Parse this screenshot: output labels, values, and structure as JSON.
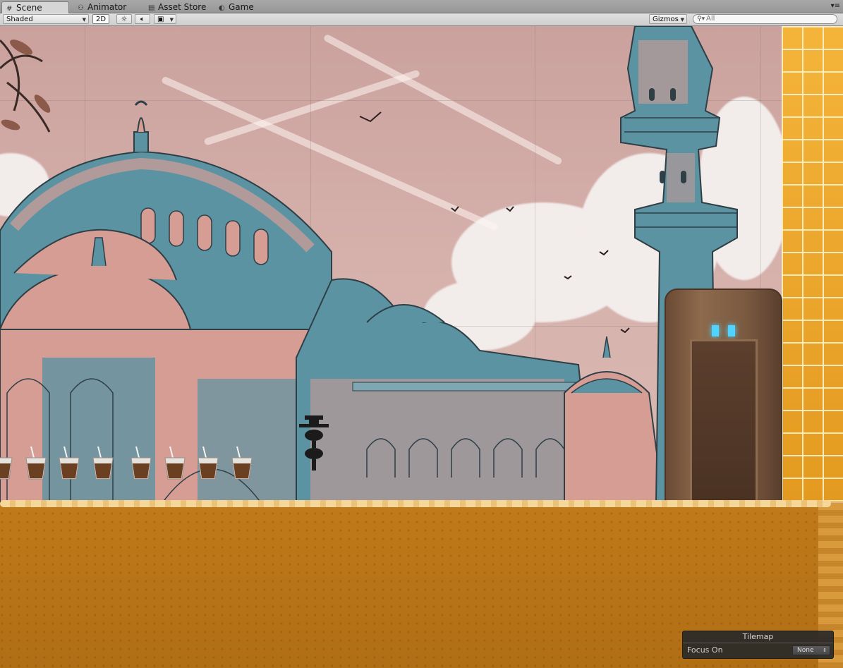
{
  "tabs": [
    {
      "label": "Scene",
      "icon": "grid-icon",
      "active": true
    },
    {
      "label": "Animator",
      "icon": "animator-icon",
      "active": false
    },
    {
      "label": "Asset Store",
      "icon": "store-icon",
      "active": false
    },
    {
      "label": "Game",
      "icon": "game-icon",
      "active": false
    }
  ],
  "toolbar": {
    "shading_mode": "Shaded",
    "mode_2d": "2D",
    "lighting_icon": "sun-icon",
    "audio_icon": "speaker-icon",
    "effects_icon": "image-icon",
    "gizmos": "Gizmos",
    "search_placeholder": "All"
  },
  "tilemap_overlay": {
    "title": "Tilemap",
    "focus_label": "Focus On",
    "focus_value": "None"
  },
  "colors": {
    "sky": "#d6b0ab",
    "mosque_blue": "#5d94a3",
    "mosque_pink": "#d69d95",
    "ground": "#b46f16",
    "bricks": "#f0ab2f",
    "door": "#7d5b42",
    "door_glow": "#4fd4ff"
  }
}
